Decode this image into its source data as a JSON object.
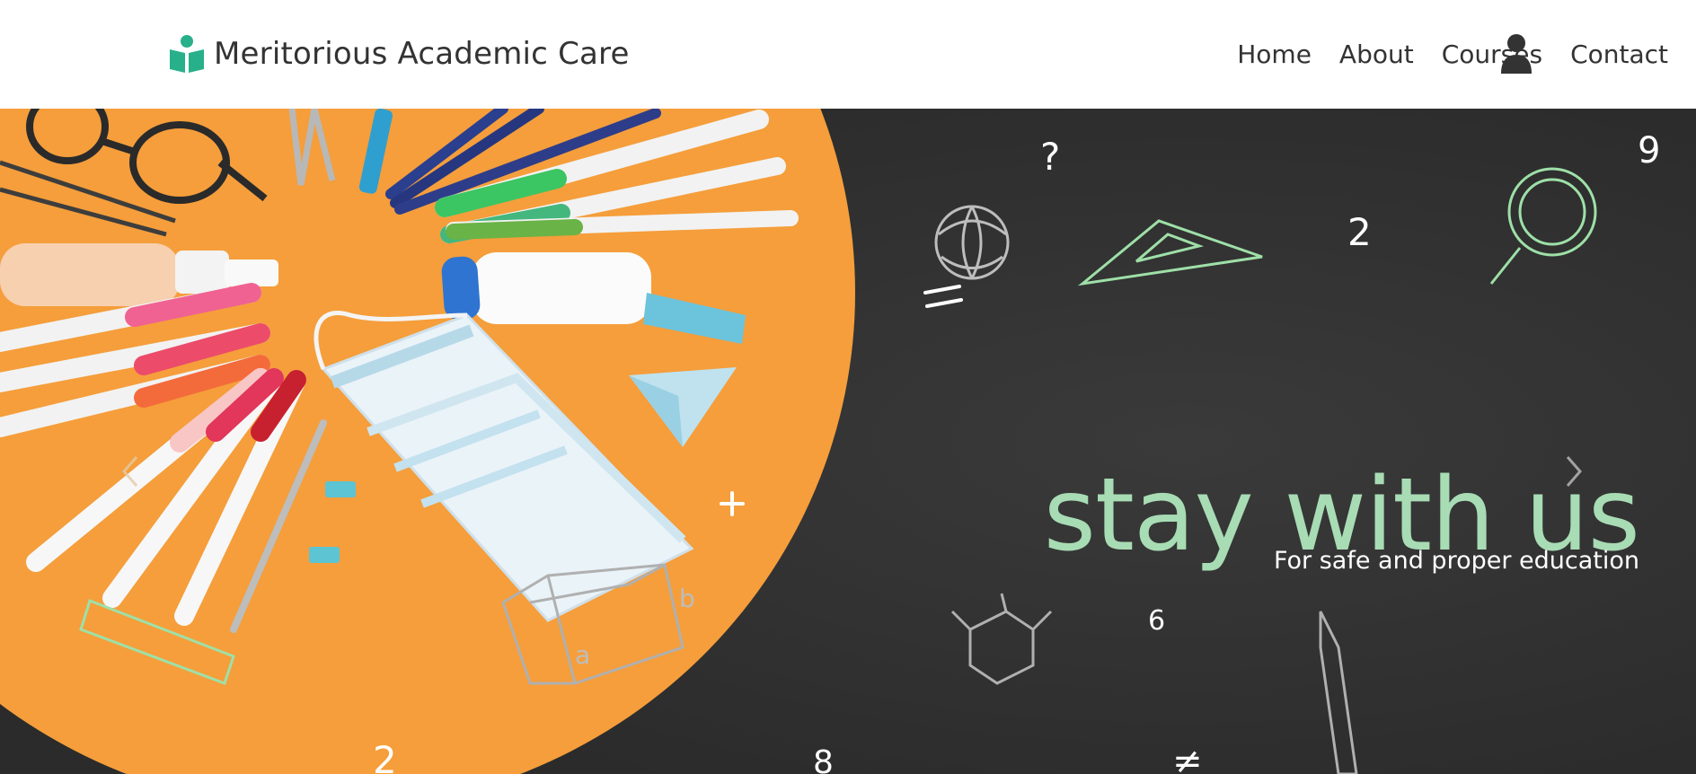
{
  "brand": {
    "name": "Meritorious Academic Care",
    "icon": "book-reader-icon",
    "icon_color": "#27b08a"
  },
  "nav": {
    "items": [
      {
        "label": "Home"
      },
      {
        "label": "About"
      },
      {
        "label": "Courses"
      },
      {
        "label": "Contact"
      }
    ],
    "user_icon": "user-icon"
  },
  "hero": {
    "title": "stay with us",
    "subtitle": "For safe and proper education",
    "title_color": "#a8dcb4",
    "background_color": "#2f2f2f",
    "accent_color": "#f59e3b",
    "chalk_symbols": [
      "?",
      "9",
      "2",
      "=",
      "+",
      "6",
      "2",
      "8",
      "≠",
      "a",
      "b"
    ],
    "prev_icon": "chevron-left-icon",
    "next_icon": "chevron-right-icon"
  }
}
